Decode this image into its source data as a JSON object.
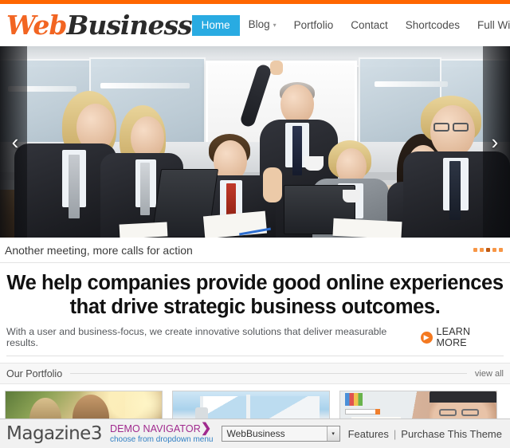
{
  "header": {
    "logo": {
      "part1": "Web",
      "part2": "Business",
      "color1": "#f26522",
      "color2": "#2b2b2b"
    },
    "nav": [
      {
        "label": "Home",
        "active": true,
        "caret": ""
      },
      {
        "label": "Blog",
        "active": false,
        "caret": "▾"
      },
      {
        "label": "Portfolio",
        "active": false,
        "caret": ""
      },
      {
        "label": "Contact",
        "active": false,
        "caret": ""
      },
      {
        "label": "Shortcodes",
        "active": false,
        "caret": ""
      },
      {
        "label": "Full Width",
        "active": false,
        "caret": ""
      }
    ],
    "active_color": "#29abe2",
    "top_rule_color": "#ff6600"
  },
  "slider": {
    "prev_icon": "‹",
    "next_icon": "›",
    "caption": "Another meeting, more calls for action",
    "dots_total": 5,
    "dots_active_index": 2,
    "dot_color": "#f79646",
    "dot_active_color": "#c05a12",
    "scene_description": "Business meeting in glass-walled office"
  },
  "hero": {
    "headline_line1": "We help companies provide good online experiences",
    "headline_line2": "that drive strategic business outcomes.",
    "subtext": "With a user and business-focus, we create innovative solutions that deliver measurable results.",
    "cta_label": "LEARN MORE",
    "cta_icon": "▶",
    "cta_color": "#f47920"
  },
  "portfolio": {
    "title": "Our Portfolio",
    "view_all": "view all",
    "items": [
      {
        "alt": "Two men outdoors among vines in sunlight"
      },
      {
        "alt": "Vintage truck windshield against blue sky"
      },
      {
        "alt": "Older man in cap and glasses with Vote YES sign"
      }
    ]
  },
  "bottombar": {
    "brand": "Magazine3",
    "demo_nav_title": "DEMO NAVIGATOR",
    "demo_nav_arrow": "❯",
    "demo_nav_sub": "choose from dropdown menu",
    "select_value": "WebBusiness",
    "select_arrow": "▾",
    "link_features": "Features",
    "separator": "|",
    "link_purchase": "Purchase This Theme",
    "title_color": "#a02a8e",
    "sub_color": "#2f7fc4"
  }
}
